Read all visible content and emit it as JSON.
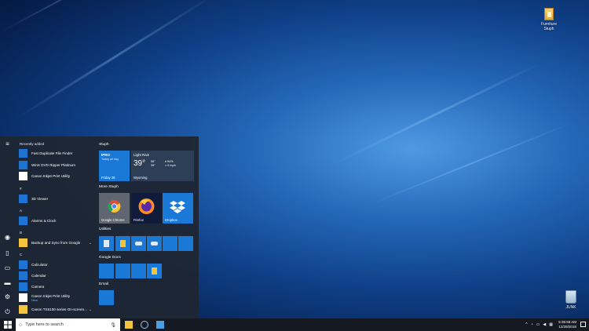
{
  "desktop": {
    "icons": [
      {
        "label_line1": "Furniture",
        "label_line2": "Stuph"
      },
      {
        "label_line1": "JUNK",
        "label_line2": ""
      }
    ]
  },
  "start_menu": {
    "recently_added_label": "Recently added",
    "recent": [
      {
        "label": "Fast Duplicate File Finder"
      },
      {
        "label": "WinX DVD Ripper Platinum"
      },
      {
        "label": "Canon Inkjet Print Utility"
      }
    ],
    "sections": [
      {
        "letter": "#",
        "apps": [
          {
            "label": "3D Viewer"
          }
        ]
      },
      {
        "letter": "A",
        "apps": [
          {
            "label": "Alarms & Clock"
          }
        ]
      },
      {
        "letter": "B",
        "apps": [
          {
            "label": "Backup and Sync from Google"
          }
        ]
      },
      {
        "letter": "C",
        "apps": [
          {
            "label": "Calculator"
          },
          {
            "label": "Calendar"
          },
          {
            "label": "Camera"
          },
          {
            "label": "Canon Inkjet Print Utility",
            "sub": "New"
          },
          {
            "label": "Canon TS5100 series On-screen..."
          }
        ]
      }
    ],
    "tile_groups": {
      "stuph": "Stuph",
      "more_stuph": "More Stuph",
      "utilities": "Utilities",
      "google_docs": "Google Docs",
      "email": "Email"
    },
    "tiles": {
      "ipro": {
        "line1": "IPRO",
        "line2": "Today all day",
        "date": "Friday 28"
      },
      "weather": {
        "condition": "Light Rain",
        "temp": "39°",
        "hi": "56°",
        "lo": "39°",
        "humidity": "94%",
        "wind": "0 mph",
        "city": "Wyoming"
      },
      "chrome": "Google Chrome",
      "firefox": "Firefox",
      "dropbox": "Dropbox"
    }
  },
  "taskbar": {
    "search_placeholder": "Type here to search",
    "time": "5:36:58 AM",
    "date": "12/28/2018"
  },
  "colors": {
    "tile_blue": "#1a78d6",
    "menu_bg": "#1e2634",
    "taskbar_bg": "#151a22"
  }
}
